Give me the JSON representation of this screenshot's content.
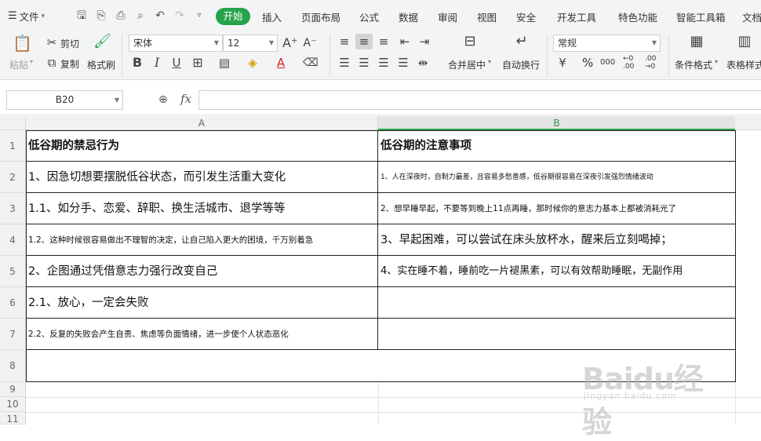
{
  "menubar": {
    "file_label": "文件",
    "active_tab": "开始",
    "tabs": [
      "插入",
      "页面布局",
      "公式",
      "数据",
      "审阅",
      "视图",
      "安全",
      "开发工具",
      "特色功能",
      "智能工具箱",
      "文档"
    ]
  },
  "ribbon": {
    "paste_label": "粘贴",
    "cut_label": "剪切",
    "copy_label": "复制",
    "format_painter_label": "格式刷",
    "font_name": "宋体",
    "font_size": "12",
    "merge_center_label": "合并居中",
    "wrap_text_label": "自动换行",
    "number_format": "常规",
    "conditional_format_label": "条件格式",
    "table_style_label": "表格样式",
    "percent_symbol": "%",
    "thousands_symbol": "000",
    "inc_decimal": "←0 .00",
    "dec_decimal": ".00 →0",
    "accent_green": "#26a34b"
  },
  "formula_bar": {
    "cell_ref": "B20",
    "fx_label": "fx",
    "formula_value": ""
  },
  "grid": {
    "columns": [
      "A",
      "B"
    ],
    "row_numbers": [
      "1",
      "2",
      "3",
      "4",
      "5",
      "6",
      "7",
      "8",
      "9",
      "10",
      "11"
    ],
    "rows": [
      {
        "a": "低谷期的禁忌行为",
        "b": "低谷期的注意事项"
      },
      {
        "a": "1、因急切想要摆脱低谷状态，而引发生活重大变化",
        "b": "1、人在深夜时，自制力最差，且容易多愁善感，低谷期很容易在深夜引发强烈情绪波动"
      },
      {
        "a": "1.1、如分手、恋爱、辞职、换生活城市、退学等等",
        "b": "2、想早睡早起，不要等到晚上11点再睡，那时候你的意志力基本上都被消耗光了"
      },
      {
        "a": "1.2、这种时候很容易做出不理智的决定，让自己陷入更大的困境，千万别着急",
        "b": "3、早起困难，可以尝试在床头放杯水，醒来后立刻喝掉；"
      },
      {
        "a": "2、企图通过凭借意志力强行改变自己",
        "b": "4、实在睡不着，睡前吃一片褪黑素，可以有效帮助睡眠，无副作用"
      },
      {
        "a": "2.1、放心，一定会失败",
        "b": ""
      },
      {
        "a": "2.2、反复的失败会产生自责、焦虑等负面情绪，进一步使个人状态恶化",
        "b": ""
      },
      {
        "a": "",
        "b": ""
      }
    ]
  },
  "watermark": {
    "main": "Baidu经验",
    "sub": "jingyan.baidu.com"
  }
}
